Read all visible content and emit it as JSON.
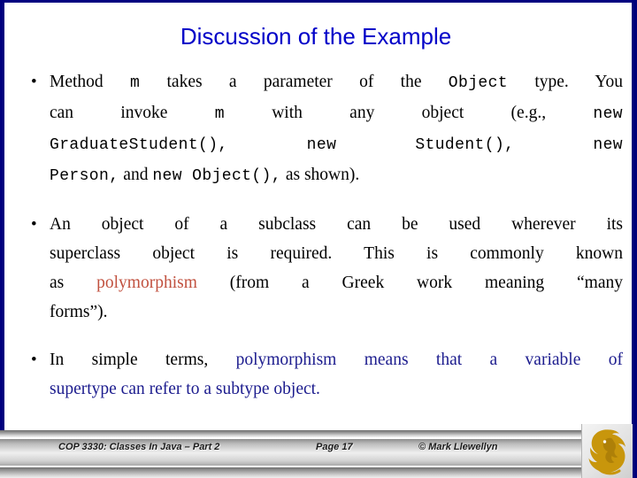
{
  "slide": {
    "title": "Discussion of the Example",
    "title_color": "#0000c8",
    "frame_color": "#000080",
    "background": "#ffffff"
  },
  "colors": {
    "accent_red": "#c1513f",
    "accent_navy": "#1c1c8e",
    "logo_gold": "#c8960c"
  },
  "bullets": [
    {
      "marker": "•",
      "lines": [
        {
          "segments": [
            {
              "text": "Method ",
              "style": "serif"
            },
            {
              "text": "m",
              "style": "mono"
            },
            {
              "text": " takes a parameter of the ",
              "style": "serif"
            },
            {
              "text": "Object",
              "style": "mono"
            },
            {
              "text": " type.  You",
              "style": "serif"
            }
          ]
        },
        {
          "segments": [
            {
              "text": "can invoke ",
              "style": "serif"
            },
            {
              "text": "m",
              "style": "mono"
            },
            {
              "text": " with any object (e.g., ",
              "style": "serif"
            },
            {
              "text": "new",
              "style": "mono"
            }
          ]
        },
        {
          "segments": [
            {
              "text": "GraduateStudent(), new Student(), new",
              "style": "mono"
            }
          ]
        },
        {
          "segments": [
            {
              "text": "Person,",
              "style": "mono"
            },
            {
              "text": " and ",
              "style": "serif"
            },
            {
              "text": "new Object(),",
              "style": "mono"
            },
            {
              "text": " as shown).",
              "style": "serif"
            }
          ]
        }
      ]
    },
    {
      "marker": "•",
      "lines": [
        {
          "segments": [
            {
              "text": "An object of a subclass can be used wherever its",
              "style": "serif"
            }
          ]
        },
        {
          "segments": [
            {
              "text": "superclass object is required.  This is commonly known",
              "style": "serif"
            }
          ]
        },
        {
          "segments": [
            {
              "text": "as ",
              "style": "serif"
            },
            {
              "text": "polymorphism",
              "style": "serif-red"
            },
            {
              "text": " (from a Greek work meaning “many",
              "style": "serif"
            }
          ]
        },
        {
          "segments": [
            {
              "text": "forms”).",
              "style": "serif"
            }
          ]
        }
      ]
    },
    {
      "marker": "•",
      "lines": [
        {
          "segments": [
            {
              "text": "In simple terms, ",
              "style": "serif"
            },
            {
              "text": "polymorphism means that a variable of",
              "style": "serif-navy"
            }
          ]
        },
        {
          "segments": [
            {
              "text": "supertype can refer to a subtype object.",
              "style": "serif-navy"
            }
          ]
        }
      ]
    }
  ],
  "footer": {
    "course": "COP 3330:  Classes In Java – Part 2",
    "page": "Page 17",
    "author": "© Mark Llewellyn",
    "logo_name": "ucf-pegasus-logo"
  }
}
